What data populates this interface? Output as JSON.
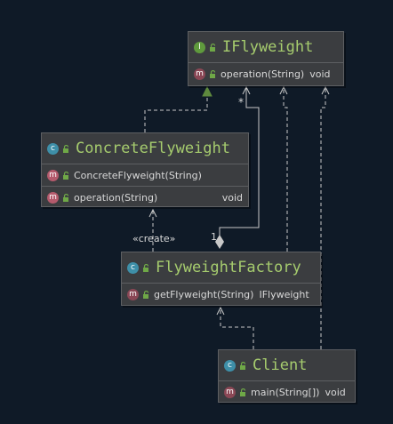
{
  "classes": {
    "iflyweight": {
      "name": "IFlyweight",
      "kind_badge": "I",
      "methods": [
        {
          "badge": "m",
          "name": "operation(String)",
          "ret": "void"
        }
      ]
    },
    "concrete": {
      "name": "ConcreteFlyweight",
      "kind_badge": "c",
      "constructors": [
        {
          "badge": "m",
          "name": "ConcreteFlyweight(String)"
        }
      ],
      "methods": [
        {
          "badge": "m",
          "name": "operation(String)",
          "ret": "void"
        }
      ]
    },
    "factory": {
      "name": "FlyweightFactory",
      "kind_badge": "c",
      "methods": [
        {
          "badge": "m",
          "name": "getFlyweight(String)",
          "ret": "IFlyweight"
        }
      ]
    },
    "client": {
      "name": "Client",
      "kind_badge": "c",
      "methods": [
        {
          "badge": "m",
          "name": "main(String[])",
          "ret": "void"
        }
      ]
    }
  },
  "labels": {
    "create": "«create»",
    "mult_many": "*",
    "mult_one": "1"
  },
  "colors": {
    "background": "#0f1a27",
    "box": "#3b3d40",
    "class_name": "#a6cc6e",
    "edge": "#c8c8c8",
    "inherit_arrow": "#5f8a3e"
  }
}
